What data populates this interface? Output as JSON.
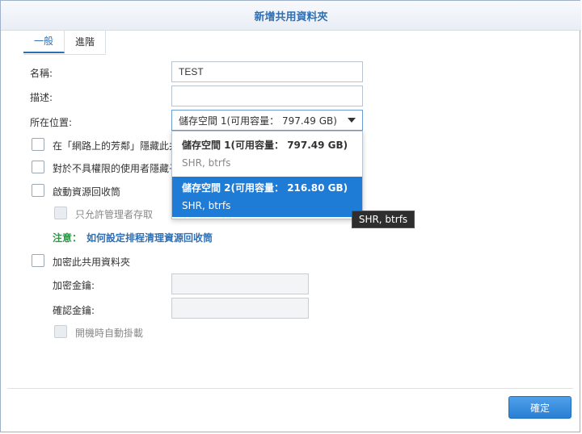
{
  "window": {
    "title": "新增共用資料夾"
  },
  "tabs": [
    {
      "label": "一般"
    },
    {
      "label": "進階"
    }
  ],
  "form": {
    "name_label": "名稱:",
    "name_value": "TEST",
    "desc_label": "描述:",
    "desc_value": "",
    "location_label": "所在位置:",
    "location_value": "儲存空間 1(可用容量： 797.49 GB)",
    "hide_network_label": "在「網路上的芳鄰」隱藏此共",
    "hide_subfolders_label": "對於不具權限的使用者隱藏子",
    "recycle_bin_label": "啟動資源回收筒",
    "admin_only_label": "只允許管理者存取",
    "note_prefix": "注意：",
    "note_link": "如何設定排程清理資源回收筒",
    "encrypt_label": "加密此共用資料夾",
    "encrypt_key_label": "加密金鑰:",
    "confirm_key_label": "確認金鑰:",
    "auto_mount_label": "開機時自動掛載"
  },
  "dropdown": {
    "options": [
      {
        "title": "儲存空間 1(可用容量： 797.49 GB)",
        "subtitle": "SHR, btrfs",
        "selected": false
      },
      {
        "title": "儲存空間 2(可用容量： 216.80 GB)",
        "subtitle": "SHR, btrfs",
        "selected": true
      }
    ]
  },
  "tooltip": {
    "text": "SHR, btrfs"
  },
  "footer": {
    "ok_label": "確定"
  },
  "colors": {
    "accent": "#2f6fb3",
    "selected_bg": "#1e7bd6",
    "note_green": "#2a9a46"
  }
}
